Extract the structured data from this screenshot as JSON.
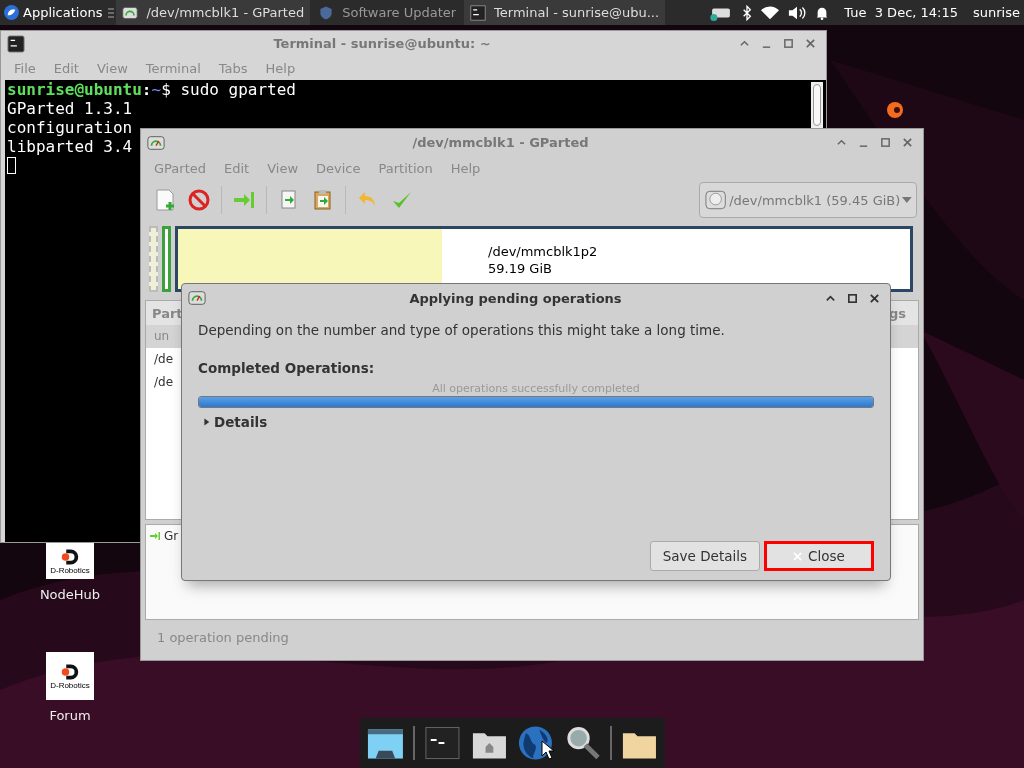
{
  "panel": {
    "menu": "Applications",
    "tasks": [
      {
        "label": "/dev/mmcblk1 - GParted",
        "kind": "gparted",
        "minimized": false
      },
      {
        "label": "Software Updater",
        "kind": "updater",
        "minimized": true
      },
      {
        "label": "Terminal - sunrise@ubu...",
        "kind": "terminal",
        "minimized": false
      }
    ],
    "clock": "Tue  3 Dec, 14:15",
    "user": "sunrise"
  },
  "desktop_icons": [
    {
      "label": "NodeHub",
      "logo_text": "D-Robotics"
    },
    {
      "label": "Forum",
      "logo_text": "D-Robotics"
    }
  ],
  "terminal": {
    "title": "Terminal - sunrise@ubuntu: ~",
    "menu": [
      "File",
      "Edit",
      "View",
      "Terminal",
      "Tabs",
      "Help"
    ],
    "prompt": [
      {
        "text": "sunrise@ubuntu",
        "color": "#5ee05e"
      },
      {
        "text": ":",
        "color": "#ffffff"
      },
      {
        "text": "~",
        "color": "#7b8cff"
      },
      {
        "text": "$ sudo gparted",
        "color": "#ffffff"
      }
    ],
    "lines": [
      "GParted 1.3.1",
      "configuration",
      "libparted 3.4"
    ]
  },
  "gparted": {
    "title": "/dev/mmcblk1 - GParted",
    "menu": [
      "GParted",
      "Edit",
      "View",
      "Device",
      "Partition",
      "Help"
    ],
    "device": "/dev/mmcblk1 (59.45 GiB)",
    "disk_map": {
      "partition": "/dev/mmcblk1p2",
      "size": "59.19 GiB",
      "level": 0.36
    },
    "list": {
      "header_left": "Part",
      "header_right": "gs",
      "rows": [
        {
          "text": "un",
          "selected": true
        },
        {
          "text": "/de",
          "selected": false
        },
        {
          "text": "/de",
          "selected": false
        }
      ]
    },
    "pending": [
      "Gr"
    ],
    "status": "1 operation pending"
  },
  "dialog": {
    "title": "Applying pending operations",
    "message": "Depending on the number and type of operations this might take a long time.",
    "section": "Completed Operations:",
    "progress_text": "All operations successfully completed",
    "level": 1,
    "details": {
      "label": "Details",
      "expanded": false
    },
    "buttons": [
      {
        "label": "Save Details",
        "kind": "save",
        "highlighted": false
      },
      {
        "label": "Close",
        "kind": "close",
        "highlighted": true
      }
    ]
  }
}
